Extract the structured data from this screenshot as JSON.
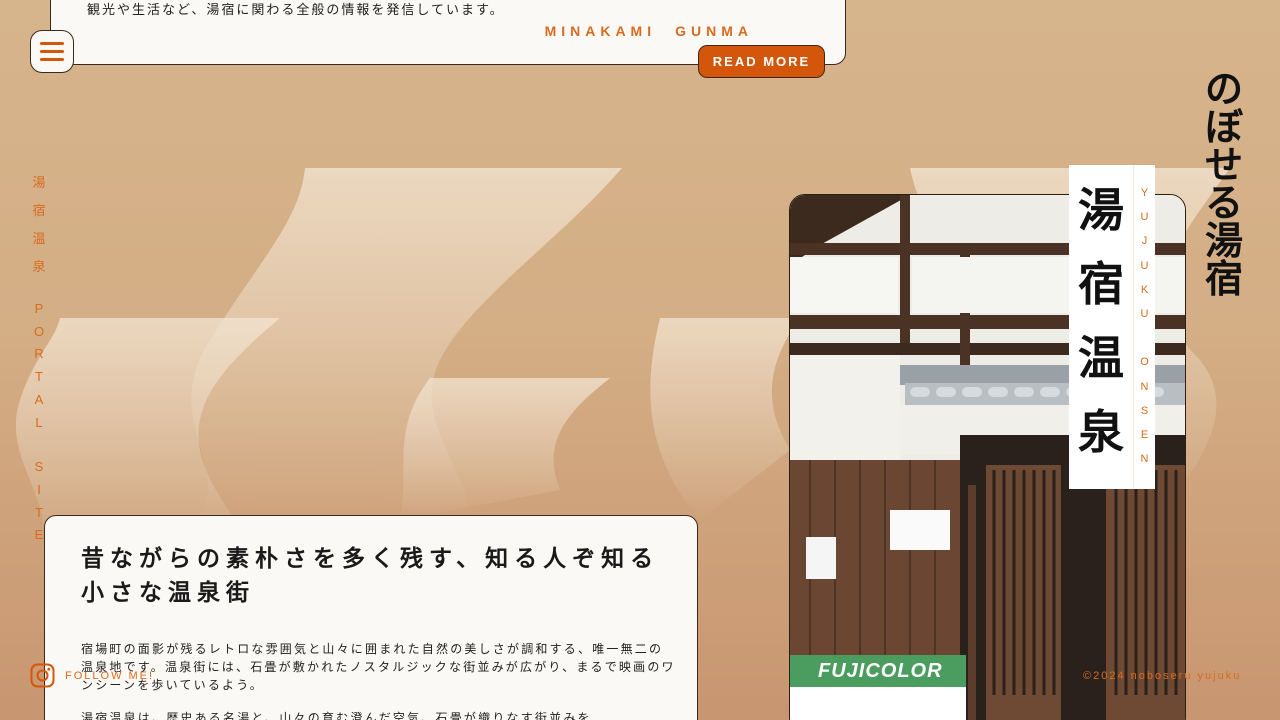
{
  "top_card": {
    "description": "観光や生活など、湯宿に関わる全般の情報を発信しています。",
    "location": "MINAKAMI　GUNMA",
    "read_more_label": "READ MORE"
  },
  "side_text": {
    "jp": [
      "湯",
      "宿",
      "温",
      "泉"
    ],
    "en_word1": [
      "P",
      "O",
      "R",
      "T",
      "A",
      "L"
    ],
    "en_word2": [
      "S",
      "I",
      "T",
      "E"
    ]
  },
  "follow": {
    "label": "FOLLOW ME!"
  },
  "copyright": "©2024 noboseru yujuku",
  "logo": {
    "chars": [
      "の",
      "ぼ",
      "せ",
      "る",
      "湯",
      "宿"
    ]
  },
  "main_card": {
    "heading": "昔ながらの素朴さを多く残す、知る人ぞ知る小さな温泉街",
    "paragraph1": "宿場町の面影が残るレトロな雰囲気と山々に囲まれた自然の美しさが調和する、唯一無二の温泉地です。温泉街には、石畳が敷かれたノスタルジックな街並みが広がり、まるで映画のワンシーンを歩いているよう。",
    "paragraph2": "湯宿温泉は、歴史ある名湯と、山々の育む澄んだ空気、石畳が織りなす街並みを"
  },
  "title_banner": {
    "jp": [
      "湯",
      "宿",
      "温",
      "泉"
    ],
    "en": [
      "Y",
      "U",
      "J",
      "U",
      "K",
      "U",
      "",
      "O",
      "N",
      "S",
      "E",
      "N"
    ]
  },
  "photo": {
    "sign_text": "FUJICOLOR"
  },
  "colors": {
    "accent": "#d4560a",
    "accent_text": "#d96b1f",
    "background": "#d6b48c"
  }
}
